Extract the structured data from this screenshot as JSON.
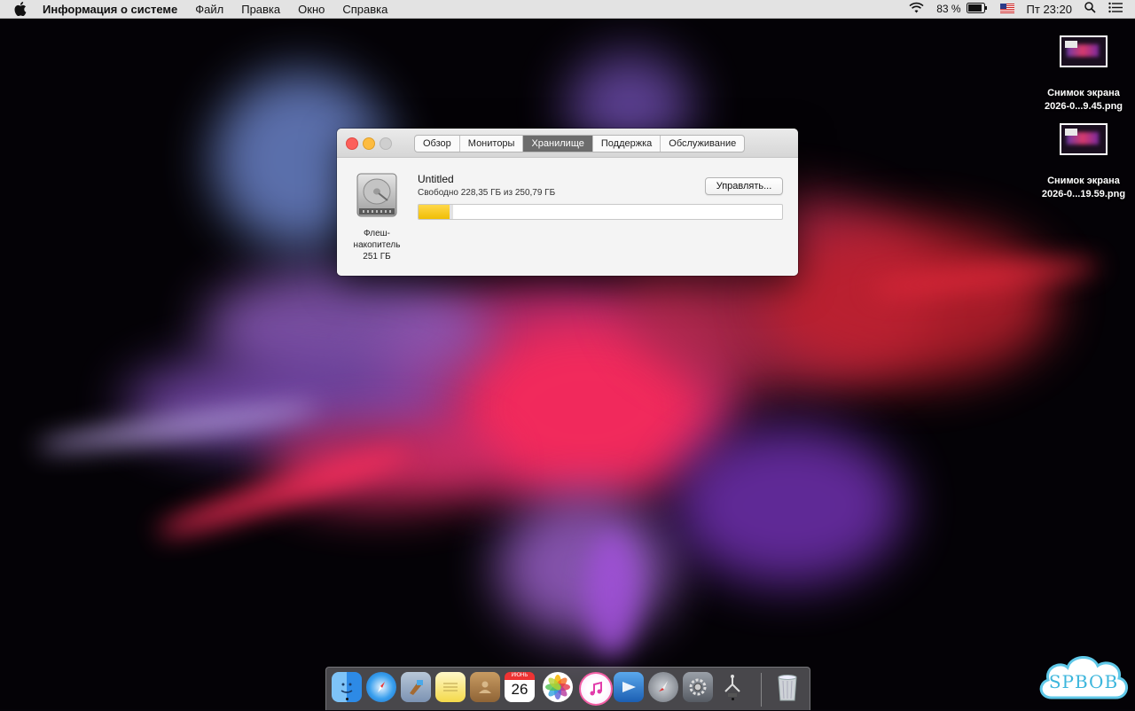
{
  "menubar": {
    "app_name": "Информация о системе",
    "menus": [
      "Файл",
      "Правка",
      "Окно",
      "Справка"
    ],
    "battery_percent": "83 %",
    "clock": "Пт 23:20"
  },
  "desktop": {
    "files": [
      {
        "name_line1": "Снимок экрана",
        "name_line2": "2026-0...9.45.png"
      },
      {
        "name_line1": "Снимок экрана",
        "name_line2": "2026-0...19.59.png"
      }
    ]
  },
  "window": {
    "tabs": [
      "Обзор",
      "Мониторы",
      "Хранилище",
      "Поддержка",
      "Обслуживание"
    ],
    "active_tab": "Хранилище",
    "disk": {
      "label_line1": "Флеш-",
      "label_line2": "накопитель",
      "label_line3": "251 ГБ"
    },
    "volume": {
      "name": "Untitled",
      "free_text": "Свободно 228,35 ГБ из 250,79 ГБ",
      "used_fraction": 0.085
    },
    "manage_button": "Управлять..."
  },
  "dock": {
    "calendar_month": "ИЮНЬ",
    "calendar_day": "26",
    "apps": [
      "finder-icon",
      "safari-icon",
      "mail-icon",
      "notes-icon",
      "contacts-icon",
      "calendar-icon",
      "photos-icon",
      "itunes-icon",
      "keynote-icon",
      "launchpad-icon",
      "system-preferences-icon",
      "utility-icon",
      "trash-icon"
    ]
  },
  "watermark": {
    "text": "SPBOB"
  },
  "colors": {
    "accent_yellow": "#f0be05",
    "tab_active": "#6c6c6c"
  }
}
